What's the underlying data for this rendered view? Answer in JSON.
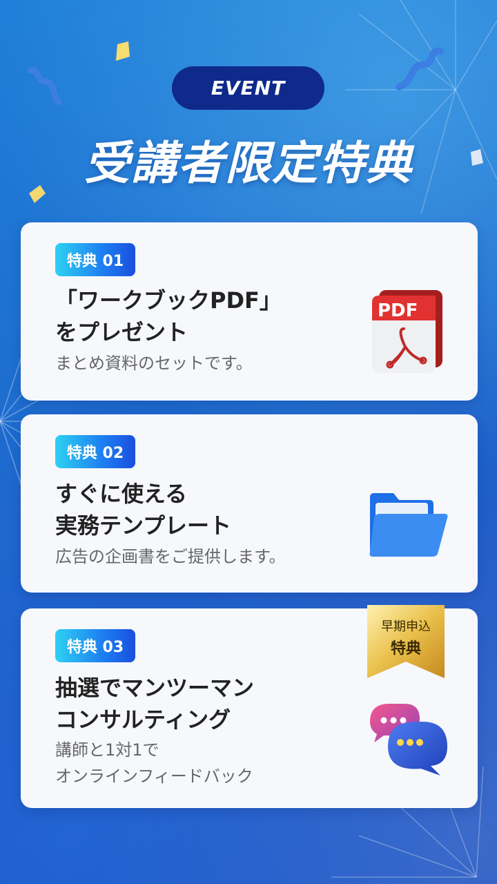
{
  "header": {
    "event_label": "EVENT",
    "title": "受講者限定特典"
  },
  "cards": [
    {
      "badge": "特典 01",
      "title_line1": "「ワークブックPDF」",
      "title_line2": "をプレゼント",
      "desc_line1": "まとめ資料のセットです。",
      "icon": "pdf-file-icon",
      "icon_label": "PDF"
    },
    {
      "badge": "特典 02",
      "title_line1": "すぐに使える",
      "title_line2": "実務テンプレート",
      "desc_line1": "広告の企画書をご提供します。",
      "icon": "folder-icon"
    },
    {
      "badge": "特典 03",
      "title_line1": "抽選でマンツーマン",
      "title_line2": "コンサルティング",
      "desc_line1": "講師と1対1で",
      "desc_line2": "オンラインフィードバック",
      "icon": "chat-bubbles-icon",
      "ribbon_line1": "早期申込",
      "ribbon_line2": "特典"
    }
  ],
  "colors": {
    "background": "#1e6fd0",
    "event_pill": "#0f2a8a",
    "badge_gradient_start": "#2fd1f3",
    "badge_gradient_end": "#1a4fe0",
    "card": "#f6f8fc",
    "ribbon_gold": "#e9bf4a"
  }
}
